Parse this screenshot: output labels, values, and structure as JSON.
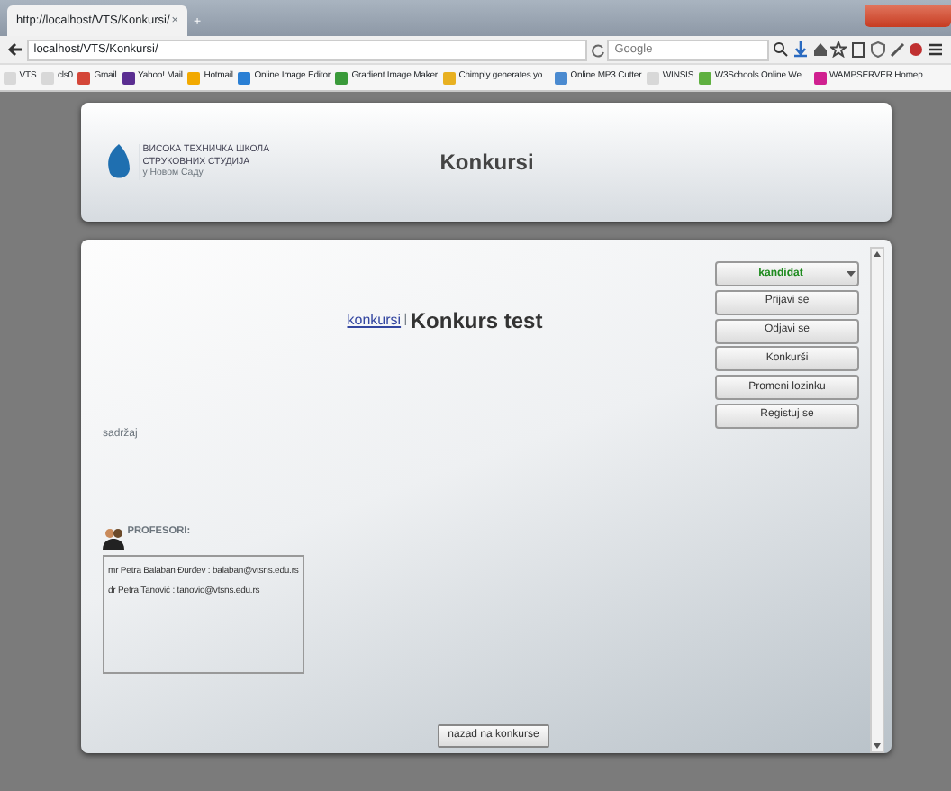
{
  "browser": {
    "tab_title": "http://localhost/VTS/Konkursi/",
    "tab_close": "×",
    "new_tab": "+",
    "address": "localhost/VTS/Konkursi/",
    "search_placeholder": "Google",
    "bookmarks": [
      {
        "label": "VTS",
        "color": "#d8d8d8"
      },
      {
        "label": "cls0",
        "color": "#d8d8d8"
      },
      {
        "label": "Gmail",
        "color": "#d44638"
      },
      {
        "label": "Yahoo! Mail",
        "color": "#5a2d91"
      },
      {
        "label": "Hotmail",
        "color": "#f2a900"
      },
      {
        "label": "Online Image Editor",
        "color": "#2a7fd4"
      },
      {
        "label": "Gradient Image Maker",
        "color": "#3a9a3a"
      },
      {
        "label": "Chimply generates yo...",
        "color": "#e8b020"
      },
      {
        "label": "Online MP3 Cutter",
        "color": "#4a8ad0"
      },
      {
        "label": "WINSIS",
        "color": "#d8d8d8"
      },
      {
        "label": "W3Schools Online We...",
        "color": "#5fb040"
      },
      {
        "label": "WAMPSERVER Homep...",
        "color": "#d02090"
      }
    ]
  },
  "header": {
    "school_lines": [
      "ВИСОКА ТЕХНИЧКА ШКОЛА",
      "СТРУКОВНИХ СТУДИЈА",
      "у Новом Саду"
    ],
    "title": "Konkursi"
  },
  "breadcrumb": {
    "link": "konkursi",
    "separator": "|",
    "current": "Konkurs test"
  },
  "role_select": {
    "value": "kandidat"
  },
  "menu_buttons": [
    "Prijavi se",
    "Odjavi se",
    "Konkurši",
    "Promeni lozinku",
    "Registuj se"
  ],
  "content_label": "sadržaj",
  "professors": {
    "heading": "PROFESORI:",
    "items": [
      "mr Petra Balaban Đurđev : balaban@vtsns.edu.rs",
      "dr Petra Tanović : tanovic@vtsns.edu.rs"
    ]
  },
  "back_button": "nazad na konkurse"
}
